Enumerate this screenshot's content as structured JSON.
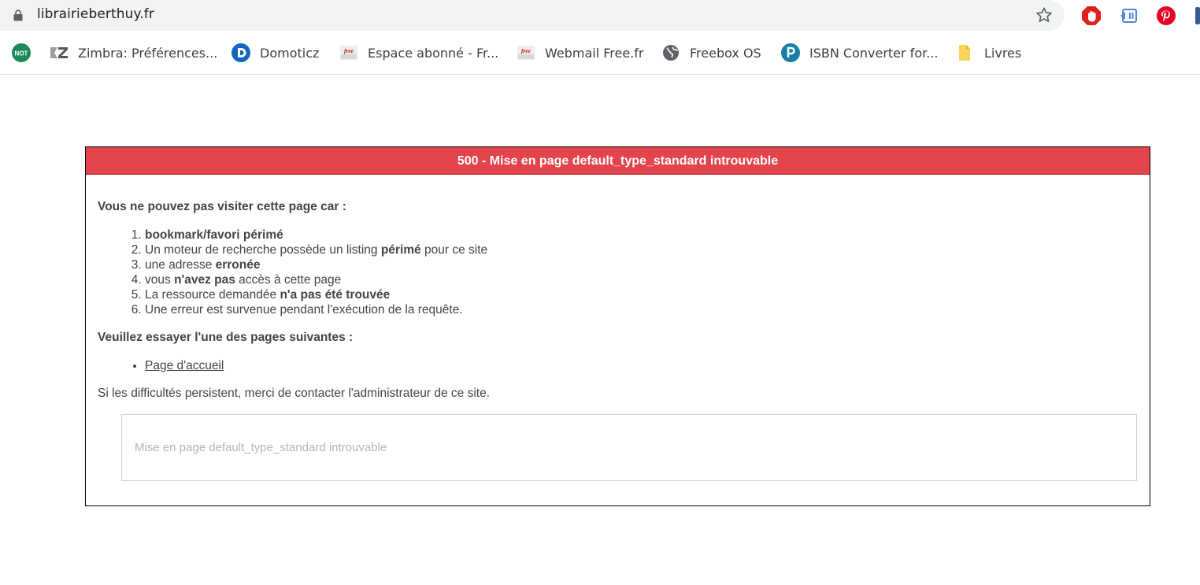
{
  "browser": {
    "url": "librairieberthuy.fr",
    "icons": {
      "lock": "lock-icon",
      "star": "bookmark-star-icon",
      "extensions": [
        "stop-sign-icon",
        "arrow-extension-icon",
        "pinterest-icon"
      ]
    },
    "bookmarks": [
      {
        "label": "",
        "icon": "not-badge-icon",
        "color": "#1b8a5a"
      },
      {
        "label": "Zimbra: Préférences...",
        "icon": "zimbra-icon"
      },
      {
        "label": "Domoticz",
        "icon": "domoticz-icon",
        "color": "#1565c0"
      },
      {
        "label": "Espace abonné - Fr...",
        "icon": "free-icon",
        "color": "#cc0000"
      },
      {
        "label": "Webmail Free.fr",
        "icon": "free-icon",
        "color": "#cc0000"
      },
      {
        "label": "Freebox OS",
        "icon": "globe-icon"
      },
      {
        "label": "ISBN Converter for...",
        "icon": "isbn-p-icon",
        "color": "#1a7fa8"
      },
      {
        "label": "Livres",
        "icon": "folder-icon",
        "color": "#fbd35a"
      }
    ]
  },
  "page": {
    "title": "500 - Mise en page default_type_standard introuvable",
    "cannot_visit": "Vous ne pouvez pas visiter cette page car :",
    "reasons": [
      [
        {
          "t": "bookmark/favori périmé",
          "b": true
        }
      ],
      [
        {
          "t": "Un moteur de recherche possède un listing ",
          "b": false
        },
        {
          "t": "périmé",
          "b": true
        },
        {
          "t": " pour ce site",
          "b": false
        }
      ],
      [
        {
          "t": "une adresse ",
          "b": false
        },
        {
          "t": "erronée",
          "b": true
        }
      ],
      [
        {
          "t": "vous ",
          "b": false
        },
        {
          "t": "n'avez pas",
          "b": true
        },
        {
          "t": " accès à cette page",
          "b": false
        }
      ],
      [
        {
          "t": "La ressource demandée ",
          "b": false
        },
        {
          "t": "n'a pas été trouvée",
          "b": true
        }
      ],
      [
        {
          "t": "Une erreur est survenue pendant l'exécution de la requête.",
          "b": false
        }
      ]
    ],
    "try_pages": "Veuillez essayer l'une des pages suivantes :",
    "home_link": "Page d'accueil",
    "persist": "Si les difficultés persistent, merci de contacter l'administrateur de ce site.",
    "detail": "Mise en page default_type_standard introuvable",
    "colors": {
      "header_bg": "#e3434b"
    }
  }
}
